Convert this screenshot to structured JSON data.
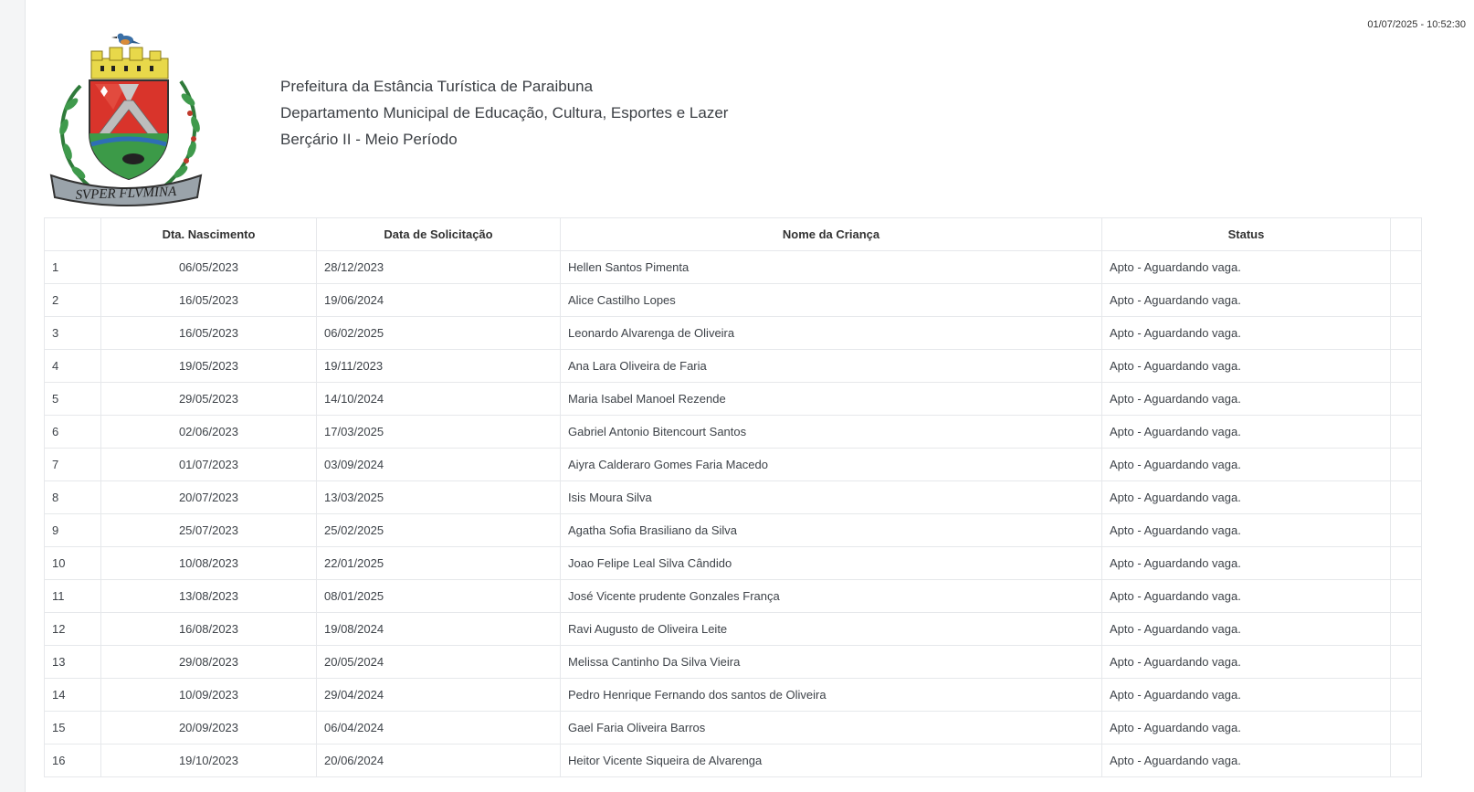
{
  "timestamp": "01/07/2025 - 10:52:30",
  "logo": {
    "motto": "SVPER FLVMINA",
    "icon": "coat-of-arms"
  },
  "header": {
    "line1": "Prefeitura da Estância Turística de Paraibuna",
    "line2": "Departamento Municipal de Educação, Cultura, Esportes e Lazer",
    "line3": "Berçário II - Meio Período"
  },
  "table": {
    "columns": [
      "",
      "Dta. Nascimento",
      "Data de Solicitação",
      "Nome da Criança",
      "Status",
      ""
    ],
    "rows": [
      [
        "1",
        "06/05/2023",
        "28/12/2023",
        "Hellen Santos Pimenta",
        "Apto - Aguardando vaga."
      ],
      [
        "2",
        "16/05/2023",
        "19/06/2024",
        "Alice Castilho Lopes",
        "Apto - Aguardando vaga."
      ],
      [
        "3",
        "16/05/2023",
        "06/02/2025",
        "Leonardo Alvarenga de Oliveira",
        "Apto - Aguardando vaga."
      ],
      [
        "4",
        "19/05/2023",
        "19/11/2023",
        "Ana Lara Oliveira de Faria",
        "Apto - Aguardando vaga."
      ],
      [
        "5",
        "29/05/2023",
        "14/10/2024",
        "Maria Isabel Manoel Rezende",
        "Apto - Aguardando vaga."
      ],
      [
        "6",
        "02/06/2023",
        "17/03/2025",
        "Gabriel Antonio Bitencourt Santos",
        "Apto - Aguardando vaga."
      ],
      [
        "7",
        "01/07/2023",
        "03/09/2024",
        "Aiyra Calderaro Gomes Faria Macedo",
        "Apto - Aguardando vaga."
      ],
      [
        "8",
        "20/07/2023",
        "13/03/2025",
        "Isis Moura Silva",
        "Apto - Aguardando vaga."
      ],
      [
        "9",
        "25/07/2023",
        "25/02/2025",
        "Agatha Sofia Brasiliano da Silva",
        "Apto - Aguardando vaga."
      ],
      [
        "10",
        "10/08/2023",
        "22/01/2025",
        "Joao Felipe Leal Silva Cândido",
        "Apto - Aguardando vaga."
      ],
      [
        "11",
        "13/08/2023",
        "08/01/2025",
        "José Vicente prudente Gonzales França",
        "Apto - Aguardando vaga."
      ],
      [
        "12",
        "16/08/2023",
        "19/08/2024",
        "Ravi Augusto de Oliveira Leite",
        "Apto - Aguardando vaga."
      ],
      [
        "13",
        "29/08/2023",
        "20/05/2024",
        "Melissa Cantinho Da Silva Vieira",
        "Apto - Aguardando vaga."
      ],
      [
        "14",
        "10/09/2023",
        "29/04/2024",
        "Pedro Henrique Fernando dos santos de Oliveira",
        "Apto - Aguardando vaga."
      ],
      [
        "15",
        "20/09/2023",
        "06/04/2024",
        "Gael Faria Oliveira Barros",
        "Apto - Aguardando vaga."
      ],
      [
        "16",
        "19/10/2023",
        "20/06/2024",
        "Heitor Vicente Siqueira de Alvarenga",
        "Apto - Aguardando vaga."
      ]
    ]
  }
}
